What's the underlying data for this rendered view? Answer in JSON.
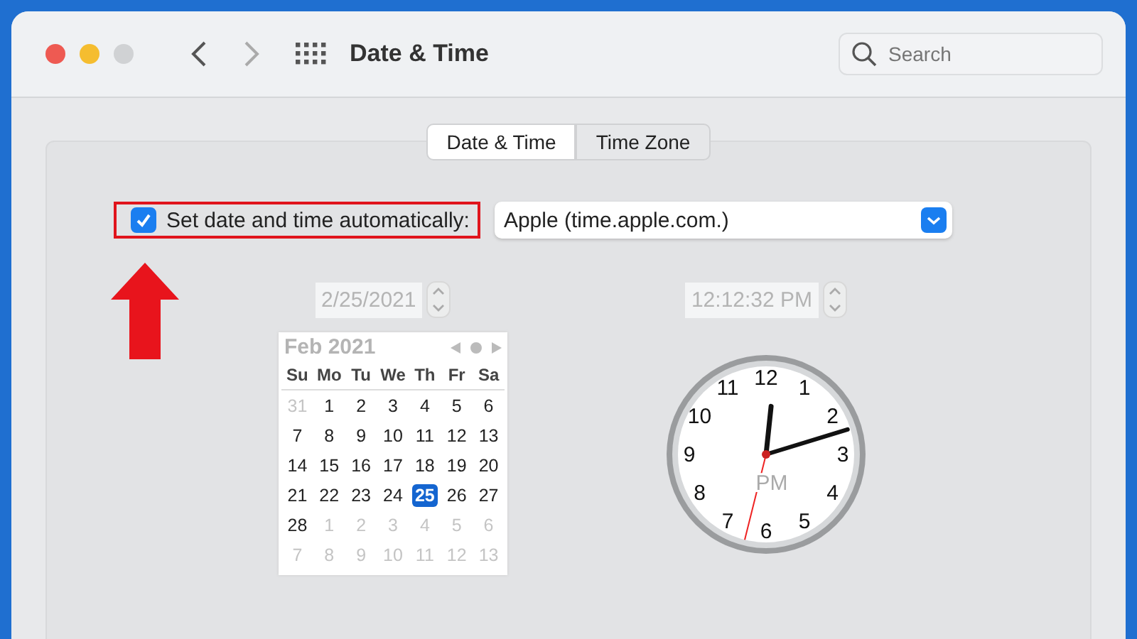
{
  "window": {
    "title": "Date & Time",
    "traffic_lights": [
      {
        "color": "#ee5a52"
      },
      {
        "color": "#f5bd2f"
      },
      {
        "color": "#d0d2d4"
      }
    ]
  },
  "search": {
    "placeholder": "Search"
  },
  "tabs": [
    {
      "label": "Date & Time",
      "selected": true
    },
    {
      "label": "Time Zone",
      "selected": false
    }
  ],
  "auto_setting": {
    "label": "Set date and time automatically:",
    "checked": true,
    "highlighted": true,
    "server": "Apple (time.apple.com.)"
  },
  "callout": {
    "kind": "arrow"
  },
  "date_field": {
    "value": "2/25/2021",
    "disabled": true
  },
  "calendar": {
    "title": "Feb 2021",
    "weekdays": [
      "Su",
      "Mo",
      "Tu",
      "We",
      "Th",
      "Fr",
      "Sa"
    ],
    "weeks": [
      [
        {
          "label": "31",
          "in_month": false,
          "selected": false
        },
        {
          "label": "1",
          "in_month": true,
          "selected": false
        },
        {
          "label": "2",
          "in_month": true,
          "selected": false
        },
        {
          "label": "3",
          "in_month": true,
          "selected": false
        },
        {
          "label": "4",
          "in_month": true,
          "selected": false
        },
        {
          "label": "5",
          "in_month": true,
          "selected": false
        },
        {
          "label": "6",
          "in_month": true,
          "selected": false
        }
      ],
      [
        {
          "label": "7",
          "in_month": true,
          "selected": false
        },
        {
          "label": "8",
          "in_month": true,
          "selected": false
        },
        {
          "label": "9",
          "in_month": true,
          "selected": false
        },
        {
          "label": "10",
          "in_month": true,
          "selected": false
        },
        {
          "label": "11",
          "in_month": true,
          "selected": false
        },
        {
          "label": "12",
          "in_month": true,
          "selected": false
        },
        {
          "label": "13",
          "in_month": true,
          "selected": false
        }
      ],
      [
        {
          "label": "14",
          "in_month": true,
          "selected": false
        },
        {
          "label": "15",
          "in_month": true,
          "selected": false
        },
        {
          "label": "16",
          "in_month": true,
          "selected": false
        },
        {
          "label": "17",
          "in_month": true,
          "selected": false
        },
        {
          "label": "18",
          "in_month": true,
          "selected": false
        },
        {
          "label": "19",
          "in_month": true,
          "selected": false
        },
        {
          "label": "20",
          "in_month": true,
          "selected": false
        }
      ],
      [
        {
          "label": "21",
          "in_month": true,
          "selected": false
        },
        {
          "label": "22",
          "in_month": true,
          "selected": false
        },
        {
          "label": "23",
          "in_month": true,
          "selected": false
        },
        {
          "label": "24",
          "in_month": true,
          "selected": false
        },
        {
          "label": "25",
          "in_month": true,
          "selected": true
        },
        {
          "label": "26",
          "in_month": true,
          "selected": false
        },
        {
          "label": "27",
          "in_month": true,
          "selected": false
        }
      ],
      [
        {
          "label": "28",
          "in_month": true,
          "selected": false
        },
        {
          "label": "1",
          "in_month": false,
          "selected": false
        },
        {
          "label": "2",
          "in_month": false,
          "selected": false
        },
        {
          "label": "3",
          "in_month": false,
          "selected": false
        },
        {
          "label": "4",
          "in_month": false,
          "selected": false
        },
        {
          "label": "5",
          "in_month": false,
          "selected": false
        },
        {
          "label": "6",
          "in_month": false,
          "selected": false
        }
      ],
      [
        {
          "label": "7",
          "in_month": false,
          "selected": false
        },
        {
          "label": "8",
          "in_month": false,
          "selected": false
        },
        {
          "label": "9",
          "in_month": false,
          "selected": false
        },
        {
          "label": "10",
          "in_month": false,
          "selected": false
        },
        {
          "label": "11",
          "in_month": false,
          "selected": false
        },
        {
          "label": "12",
          "in_month": false,
          "selected": false
        },
        {
          "label": "13",
          "in_month": false,
          "selected": false
        }
      ]
    ]
  },
  "time_field": {
    "value": "12:12:32 PM",
    "disabled": true
  },
  "clock": {
    "numerals": [
      "12",
      "1",
      "2",
      "3",
      "4",
      "5",
      "6",
      "7",
      "8",
      "9",
      "10",
      "11"
    ],
    "period": "PM"
  }
}
